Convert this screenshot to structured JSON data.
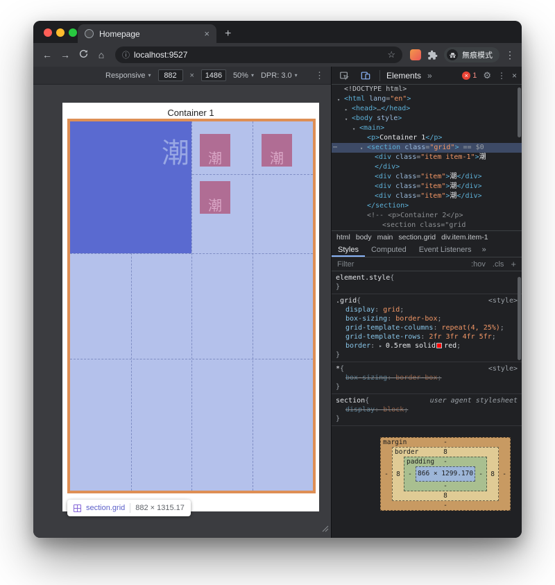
{
  "colors": {
    "accent_blue": "#8ab4f8",
    "highlight_border_orange": "#de8f55",
    "grid_overlay_blue": "#b4c1eb",
    "item1_blue": "#5a6ad0",
    "item_mauve": "#b06d94",
    "css_red_swatch": "#ff0000",
    "error_red": "#ea4335"
  },
  "browser": {
    "tab_title": "Homepage",
    "close_glyph": "×",
    "new_tab_glyph": "+",
    "back_glyph": "←",
    "forward_glyph": "→",
    "home_glyph": "⌂",
    "info_glyph": "ⓘ",
    "url": "localhost:9527",
    "star_glyph": "☆",
    "profile_label": "無痕模式",
    "menu_glyph": "⋮"
  },
  "device_toolbar": {
    "mode": "Responsive",
    "caret": "▾",
    "width": "882",
    "times": "×",
    "height": "1486",
    "zoom": "50%",
    "dpr": "DPR: 3.0",
    "menu_glyph": "⋮"
  },
  "page": {
    "title": "Container 1",
    "item1_char": "潮",
    "items": [
      "潮",
      "潮",
      "潮"
    ],
    "tooltip": {
      "label": "section.grid",
      "size": "882 × 1315.17"
    }
  },
  "devtools": {
    "toolbar": {
      "elements_tab": "Elements",
      "more_glyph": "»",
      "error_x": "×",
      "error_count": "1",
      "gear_glyph": "⚙",
      "menu_glyph": "⋮",
      "close_glyph": "×"
    },
    "tree": [
      {
        "indent": 0,
        "parts": [
          [
            "doc",
            "<!DOCTYPE html>"
          ]
        ]
      },
      {
        "indent": 0,
        "arrow": "▾",
        "parts": [
          [
            "tag",
            "<html"
          ],
          [
            "attr",
            " lang"
          ],
          [
            "pun",
            "="
          ],
          [
            "val",
            "\"en\""
          ],
          [
            "tag",
            ">"
          ]
        ]
      },
      {
        "indent": 1,
        "arrow": "▸",
        "parts": [
          [
            "tag",
            "<head>"
          ],
          [
            "pun",
            "…"
          ],
          [
            "tag",
            "</head>"
          ]
        ]
      },
      {
        "indent": 1,
        "arrow": "▾",
        "parts": [
          [
            "tag",
            "<body"
          ],
          [
            "attr",
            " style"
          ],
          [
            "tag",
            ">"
          ]
        ]
      },
      {
        "indent": 2,
        "arrow": "▾",
        "parts": [
          [
            "tag",
            "<main>"
          ]
        ]
      },
      {
        "indent": 3,
        "parts": [
          [
            "tag",
            "<p>"
          ],
          [
            "txt",
            "Container 1"
          ],
          [
            "tag",
            "</p>"
          ]
        ]
      },
      {
        "indent": 3,
        "arrow": "▾",
        "selected": true,
        "gutter": "⋯",
        "parts": [
          [
            "tag",
            "<section"
          ],
          [
            "attr",
            " class"
          ],
          [
            "pun",
            "="
          ],
          [
            "val",
            "\"grid\""
          ],
          [
            "tag",
            ">"
          ],
          [
            "eq",
            " == $0"
          ]
        ]
      },
      {
        "indent": 4,
        "parts": [
          [
            "tag",
            "<div"
          ],
          [
            "attr",
            " class"
          ],
          [
            "pun",
            "="
          ],
          [
            "val",
            "\"item item-1\""
          ],
          [
            "tag",
            ">"
          ],
          [
            "txt",
            "潮"
          ]
        ]
      },
      {
        "indent": 4,
        "parts": [
          [
            "tag",
            "</div>"
          ]
        ]
      },
      {
        "indent": 4,
        "parts": [
          [
            "tag",
            "<div"
          ],
          [
            "attr",
            " class"
          ],
          [
            "pun",
            "="
          ],
          [
            "val",
            "\"item\""
          ],
          [
            "tag",
            ">"
          ],
          [
            "txt",
            "潮"
          ],
          [
            "tag",
            "</div>"
          ]
        ]
      },
      {
        "indent": 4,
        "parts": [
          [
            "tag",
            "<div"
          ],
          [
            "attr",
            " class"
          ],
          [
            "pun",
            "="
          ],
          [
            "val",
            "\"item\""
          ],
          [
            "tag",
            ">"
          ],
          [
            "txt",
            "潮"
          ],
          [
            "tag",
            "</div>"
          ]
        ]
      },
      {
        "indent": 4,
        "parts": [
          [
            "tag",
            "<div"
          ],
          [
            "attr",
            " class"
          ],
          [
            "pun",
            "="
          ],
          [
            "val",
            "\"item\""
          ],
          [
            "tag",
            ">"
          ],
          [
            "txt",
            "潮"
          ],
          [
            "tag",
            "</div>"
          ]
        ]
      },
      {
        "indent": 3,
        "parts": [
          [
            "tag",
            "</section>"
          ]
        ]
      },
      {
        "indent": 3,
        "parts": [
          [
            "com",
            "<!-- <p>Container 2</p>"
          ]
        ]
      },
      {
        "indent": 5,
        "parts": [
          [
            "com",
            "<section class=\"grid"
          ]
        ]
      }
    ],
    "breadcrumbs": [
      "html",
      "body",
      "main",
      "section.grid",
      "div.item.item-1"
    ],
    "subtabs": {
      "tabs": [
        "Styles",
        "Computed",
        "Event Listeners"
      ],
      "active": "Styles",
      "more_glyph": "»"
    },
    "filter": {
      "label": "Filter",
      "hov": ":hov",
      "cls": ".cls",
      "plus": "+"
    },
    "rules": [
      {
        "selector": "element.style",
        "link": "",
        "props": []
      },
      {
        "selector": ".grid",
        "link": "<style>",
        "props": [
          {
            "name": "display",
            "value": "grid"
          },
          {
            "name": "box-sizing",
            "value": "border-box"
          },
          {
            "name": "grid-template-columns",
            "value": "repeat(4, 25%)"
          },
          {
            "name": "grid-template-rows",
            "value": "2fr 3fr 4fr 5fr"
          },
          {
            "name": "border",
            "arrow": "▸",
            "value": "0.5rem solid",
            "swatch": "#ff0000",
            "swatch_word": "red",
            "plain": true
          }
        ]
      },
      {
        "selector": "*",
        "link": "<style>",
        "props": [
          {
            "name": "box-sizing",
            "value": "border-box",
            "struck": true
          }
        ]
      },
      {
        "selector": "section",
        "link": "user agent stylesheet",
        "link_italic": true,
        "props": [
          {
            "name": "display",
            "value": "block",
            "struck": true
          }
        ]
      }
    ],
    "box_model": {
      "margin_label": "margin",
      "border_label": "border",
      "padding_label": "padding",
      "margin": {
        "top": "-",
        "right": "-",
        "bottom": "-",
        "left": "-"
      },
      "border": {
        "top": "8",
        "right": "8",
        "bottom": "8",
        "left": "8"
      },
      "padding": {
        "top": "-",
        "right": "-",
        "bottom": "-",
        "left": "-"
      },
      "content": "866 × 1299.170"
    }
  }
}
